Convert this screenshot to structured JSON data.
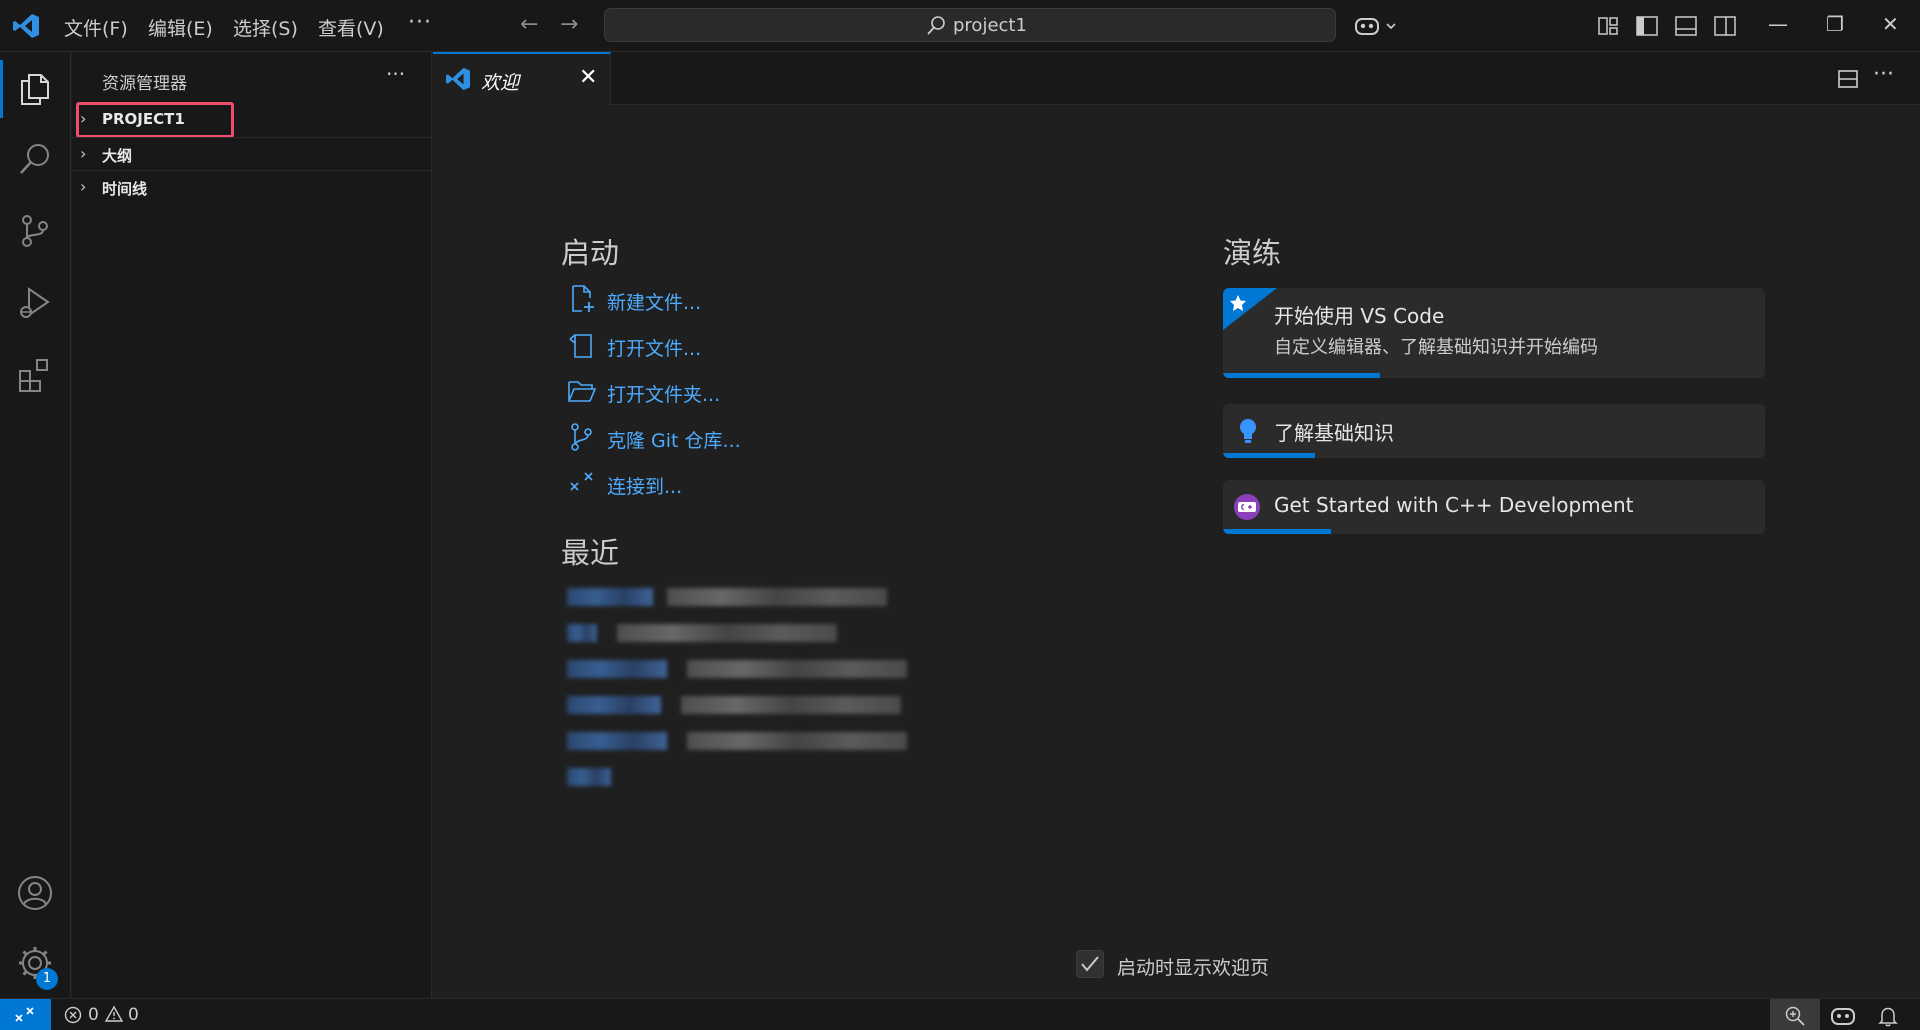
{
  "titlebar": {
    "menus": [
      "文件(F)",
      "编辑(E)",
      "选择(S)",
      "查看(V)"
    ],
    "more": "···",
    "back_arrow": "←",
    "forward_arrow": "→",
    "search_text": "project1",
    "minimize": "—",
    "restore": "❐",
    "close": "✕"
  },
  "activity_bar": {
    "items": [
      "explorer-icon",
      "search-icon",
      "source-control-icon",
      "run-debug-icon",
      "extensions-icon"
    ],
    "account": "account-icon",
    "settings": "gear-icon",
    "settings_badge": "1"
  },
  "sidebar": {
    "title": "资源管理器",
    "more": "···",
    "sections": [
      {
        "label": "PROJECT1",
        "chevron": "›"
      },
      {
        "label": "大纲",
        "chevron": "›"
      },
      {
        "label": "时间线",
        "chevron": "›"
      }
    ]
  },
  "tabs": [
    {
      "label": "欢迎",
      "close": "✕"
    }
  ],
  "editor_actions": {
    "more": "···"
  },
  "welcome": {
    "start_title": "启动",
    "start_items": [
      {
        "label": "新建文件...",
        "icon": "new-file-icon"
      },
      {
        "label": "打开文件...",
        "icon": "open-file-icon"
      },
      {
        "label": "打开文件夹...",
        "icon": "folder-open-icon"
      },
      {
        "label": "克隆 Git 仓库...",
        "icon": "git-branch-icon"
      },
      {
        "label": "连接到...",
        "icon": "remote-icon"
      }
    ],
    "recent_title": "最近",
    "walkthrough_title": "演练",
    "walkthroughs": [
      {
        "title": "开始使用 VS Code",
        "description": "自定义编辑器、了解基础知识并开始编码",
        "icon": "star-badge-icon",
        "progress": 0.29
      },
      {
        "title": "了解基础知识",
        "description": "",
        "icon": "lightbulb-icon",
        "progress": 0.17
      },
      {
        "title": "Get Started with C++ Development",
        "description": "",
        "icon": "cpp-icon",
        "progress": 0.2
      }
    ],
    "show_on_startup": "启动时显示欢迎页",
    "show_on_startup_checked": true
  },
  "statusbar": {
    "errors": "0",
    "warnings": "0"
  }
}
